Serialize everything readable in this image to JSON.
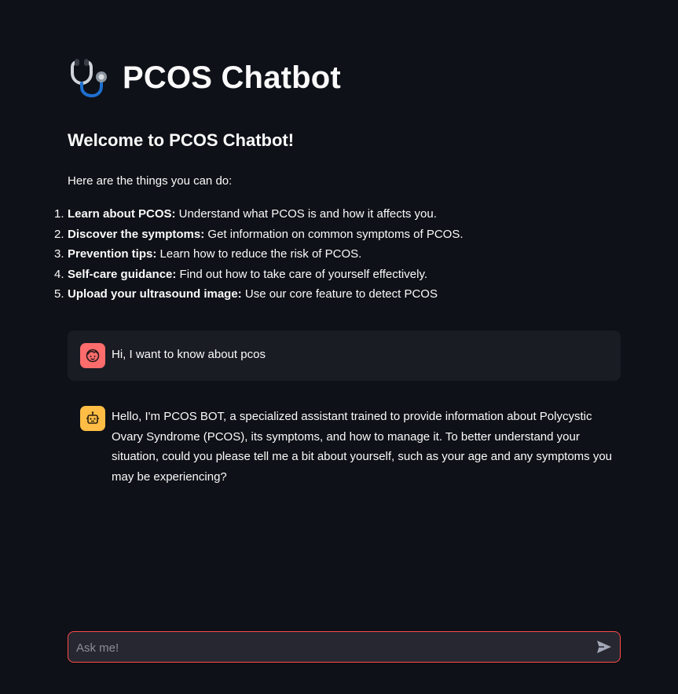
{
  "header": {
    "title": "PCOS Chatbot",
    "icon": "stethoscope-icon"
  },
  "welcome": {
    "heading": "Welcome to PCOS Chatbot!",
    "intro": "Here are the things you can do:",
    "items": [
      {
        "number": "1.",
        "bold": "Learn about PCOS:",
        "text": " Understand what PCOS is and how it affects you."
      },
      {
        "number": "2.",
        "bold": "Discover the symptoms:",
        "text": " Get information on common symptoms of PCOS."
      },
      {
        "number": "3.",
        "bold": "Prevention tips:",
        "text": " Learn how to reduce the risk of PCOS."
      },
      {
        "number": "4.",
        "bold": "Self-care guidance:",
        "text": " Find out how to take care of yourself effectively."
      },
      {
        "number": "5.",
        "bold": "Upload your ultrasound image:",
        "text": " Use our core feature to detect PCOS"
      }
    ]
  },
  "chat": {
    "messages": [
      {
        "role": "user",
        "avatar": "user-face-icon",
        "text": "Hi, I want to know about pcos"
      },
      {
        "role": "assistant",
        "avatar": "robot-icon",
        "text": "Hello, I'm PCOS BOT, a specialized assistant trained to provide information about Polycystic Ovary Syndrome (PCOS), its symptoms, and how to manage it. To better understand your situation, could you please tell me a bit about yourself, such as your age and any symptoms you may be experiencing?"
      }
    ]
  },
  "input": {
    "placeholder": "Ask me!",
    "value": "",
    "send_icon": "send-icon"
  },
  "colors": {
    "background": "#0e1117",
    "user_avatar": "#ff6c6c",
    "bot_avatar": "#ffbd45",
    "accent": "#ff4b4b"
  }
}
